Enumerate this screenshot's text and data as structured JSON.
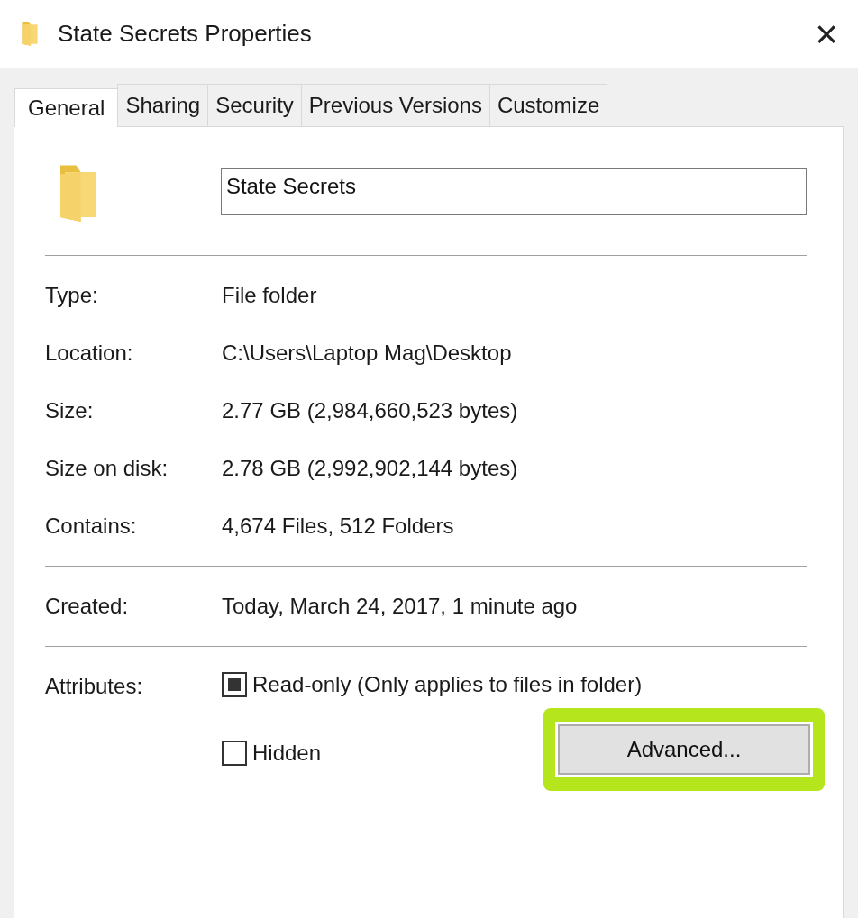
{
  "window": {
    "title": "State Secrets Properties",
    "close": "×"
  },
  "tabs": [
    {
      "label": "General",
      "selected": true
    },
    {
      "label": "Sharing",
      "selected": false
    },
    {
      "label": "Security",
      "selected": false
    },
    {
      "label": "Previous Versions",
      "selected": false
    },
    {
      "label": "Customize",
      "selected": false
    }
  ],
  "name_field": {
    "value": "State Secrets"
  },
  "sections": [
    [
      {
        "label": "Type:",
        "value": "File folder"
      },
      {
        "label": "Location:",
        "value": "C:\\Users\\Laptop Mag\\Desktop"
      },
      {
        "label": "Size:",
        "value": "2.77 GB (2,984,660,523 bytes)"
      },
      {
        "label": "Size on disk:",
        "value": "2.78 GB (2,992,902,144 bytes)"
      },
      {
        "label": "Contains:",
        "value": "4,674 Files, 512 Folders"
      }
    ],
    [
      {
        "label": "Created:",
        "value": "Today, March 24, 2017, 1 minute ago"
      }
    ]
  ],
  "attributes": {
    "label": "Attributes:",
    "items": [
      {
        "label": "Read-only (Only applies to files in folder)",
        "checked": false,
        "indeterminate": true
      },
      {
        "label": "Hidden",
        "checked": false,
        "indeterminate": false
      }
    ],
    "button": {
      "label": "Advanced...",
      "highlighted": true
    }
  }
}
